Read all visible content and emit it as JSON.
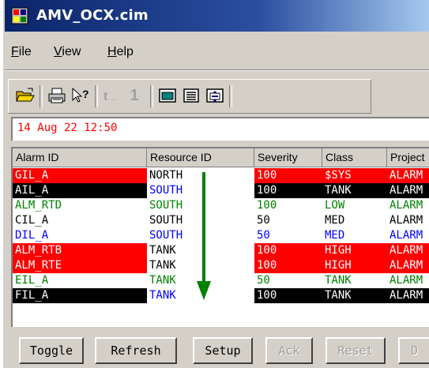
{
  "window": {
    "title": "AMV_OCX.cim"
  },
  "menu": {
    "items": [
      "File",
      "View",
      "Help"
    ],
    "accel": [
      "F",
      "V",
      "H"
    ]
  },
  "toolbar": {
    "icons": [
      "open-folder-icon",
      "print-icon",
      "context-help-icon",
      "acknowledge-icon",
      "acknowledge-one-icon",
      "window-icon",
      "list-icon",
      "properties-icon"
    ],
    "ack_label": "1"
  },
  "date": "14 Aug 22 12:50",
  "table": {
    "columns": [
      "Alarm ID",
      "Resource ID",
      "Severity",
      "Class",
      "Project"
    ],
    "rows": [
      {
        "cells": [
          "GIL_A",
          "NORTH",
          "100",
          "$SYS",
          "ALARM"
        ],
        "bg": [
          "#ff0000",
          "#ffffff",
          "#ff0000",
          "#ff0000",
          "#ff0000"
        ],
        "fg": [
          "#ffffff",
          "#000000",
          "#ffffff",
          "#ffffff",
          "#ffffff"
        ]
      },
      {
        "cells": [
          "AIL_A",
          "SOUTH",
          "100",
          "TANK",
          "ALARM"
        ],
        "bg": [
          "#000000",
          "#ffffff",
          "#000000",
          "#000000",
          "#000000"
        ],
        "fg": [
          "#ffffff",
          "#0000ff",
          "#ffffff",
          "#ffffff",
          "#ffffff"
        ]
      },
      {
        "cells": [
          "ALM_RTD",
          "SOUTH",
          "100",
          "LOW",
          "ALARM"
        ],
        "bg": [
          "#ffffff",
          "#ffffff",
          "#ffffff",
          "#ffffff",
          "#ffffff"
        ],
        "fg": [
          "#008000",
          "#008000",
          "#008000",
          "#008000",
          "#008000"
        ]
      },
      {
        "cells": [
          "CIL_A",
          "SOUTH",
          "50",
          "MED",
          "ALARM"
        ],
        "bg": [
          "#ffffff",
          "#ffffff",
          "#ffffff",
          "#ffffff",
          "#ffffff"
        ],
        "fg": [
          "#000000",
          "#000000",
          "#000000",
          "#000000",
          "#000000"
        ]
      },
      {
        "cells": [
          "DIL_A",
          "SOUTH",
          "50",
          "MED",
          "ALARM"
        ],
        "bg": [
          "#ffffff",
          "#ffffff",
          "#ffffff",
          "#ffffff",
          "#ffffff"
        ],
        "fg": [
          "#0000ff",
          "#0000ff",
          "#0000ff",
          "#0000ff",
          "#0000ff"
        ]
      },
      {
        "cells": [
          "ALM_RTB",
          "TANK",
          "100",
          "HIGH",
          "ALARM"
        ],
        "bg": [
          "#ff0000",
          "#ffffff",
          "#ff0000",
          "#ff0000",
          "#ff0000"
        ],
        "fg": [
          "#ffffff",
          "#000000",
          "#ffffff",
          "#ffffff",
          "#ffffff"
        ]
      },
      {
        "cells": [
          "ALM_RTE",
          "TANK",
          "100",
          "HIGH",
          "ALARM"
        ],
        "bg": [
          "#ff0000",
          "#ffffff",
          "#ff0000",
          "#ff0000",
          "#ff0000"
        ],
        "fg": [
          "#ffffff",
          "#000000",
          "#ffffff",
          "#ffffff",
          "#ffffff"
        ]
      },
      {
        "cells": [
          "EIL_A",
          "TANK",
          "50",
          "TANK",
          "ALARM"
        ],
        "bg": [
          "#ffffff",
          "#ffffff",
          "#ffffff",
          "#ffffff",
          "#ffffff"
        ],
        "fg": [
          "#008000",
          "#008000",
          "#008000",
          "#008000",
          "#008000"
        ]
      },
      {
        "cells": [
          "FIL_A",
          "TANK",
          "100",
          "TANK",
          "ALARM"
        ],
        "bg": [
          "#000000",
          "#ffffff",
          "#000000",
          "#000000",
          "#000000"
        ],
        "fg": [
          "#ffffff",
          "#0000ff",
          "#ffffff",
          "#ffffff",
          "#ffffff"
        ]
      }
    ]
  },
  "buttons": [
    {
      "label": "Toggle",
      "enabled": true
    },
    {
      "label": "Refresh",
      "enabled": true
    },
    {
      "label": "Setup",
      "enabled": true
    },
    {
      "label": "Ack",
      "enabled": false
    },
    {
      "label": "Reset",
      "enabled": false
    },
    {
      "label": "D",
      "enabled": false
    }
  ],
  "colors": {
    "titlebar": "#0a246a",
    "date_text": "#ff0000",
    "arrow": "#008000"
  }
}
